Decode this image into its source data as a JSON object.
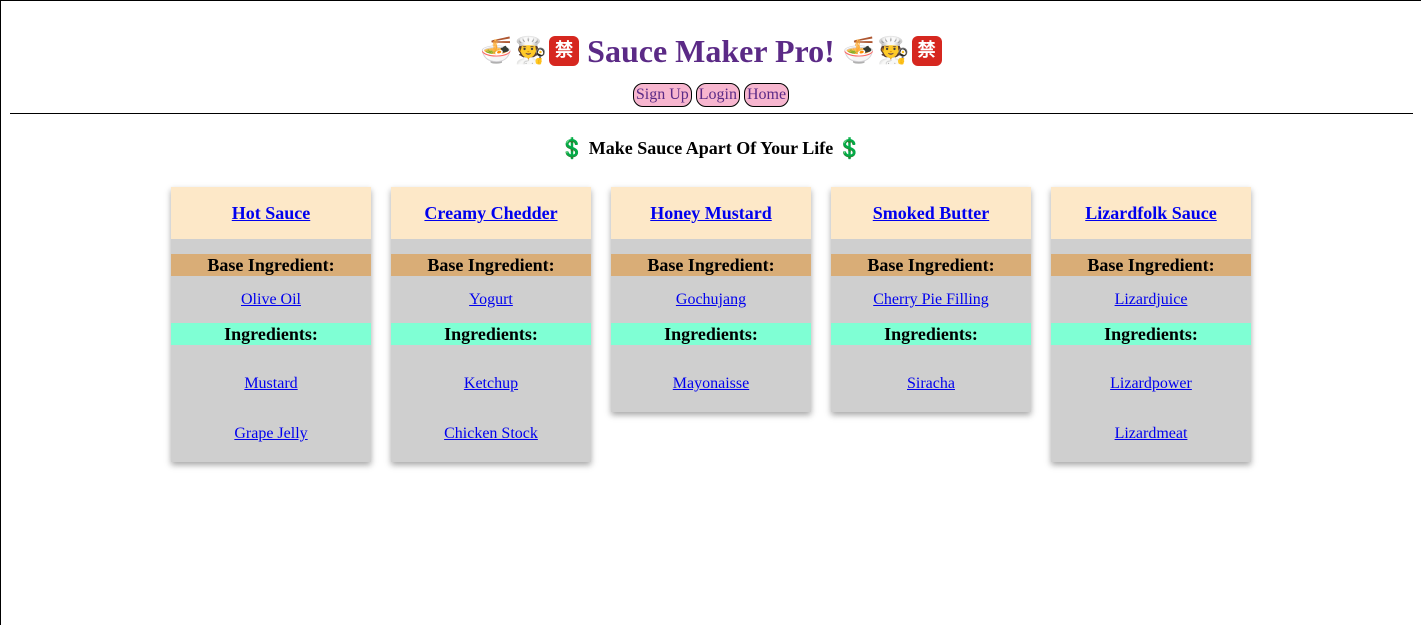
{
  "header": {
    "title": "Sauce Maker Pro!",
    "emoji_left": [
      "🍜",
      "🧑‍🍳",
      "禁"
    ],
    "emoji_right": [
      "🍜",
      "🧑‍🍳",
      "禁"
    ]
  },
  "nav": {
    "signup": "Sign Up",
    "login": "Login",
    "home": "Home"
  },
  "tagline": {
    "text": "Make Sauce Apart Of Your Life",
    "icon": "💲"
  },
  "labels": {
    "base": "Base Ingredient:",
    "ingredients": "Ingredients:"
  },
  "colors": {
    "title": "#5b2a86",
    "card_header": "#fde8c8",
    "base_band": "#d9ad77",
    "ingredients_band": "#7fffd4",
    "card_body": "#cfcfcf",
    "nav_button": "#f7b6cf"
  },
  "sauces": [
    {
      "name": "Hot Sauce",
      "base": "Olive Oil",
      "ingredients": [
        "Mustard",
        "Grape Jelly"
      ]
    },
    {
      "name": "Creamy Chedder",
      "base": "Yogurt",
      "ingredients": [
        "Ketchup",
        "Chicken Stock"
      ]
    },
    {
      "name": "Honey Mustard",
      "base": "Gochujang",
      "ingredients": [
        "Mayonaisse"
      ]
    },
    {
      "name": "Smoked Butter",
      "base": "Cherry Pie Filling",
      "ingredients": [
        "Siracha"
      ]
    },
    {
      "name": "Lizardfolk Sauce",
      "base": "Lizardjuice",
      "ingredients": [
        "Lizardpower",
        "Lizardmeat"
      ]
    }
  ]
}
